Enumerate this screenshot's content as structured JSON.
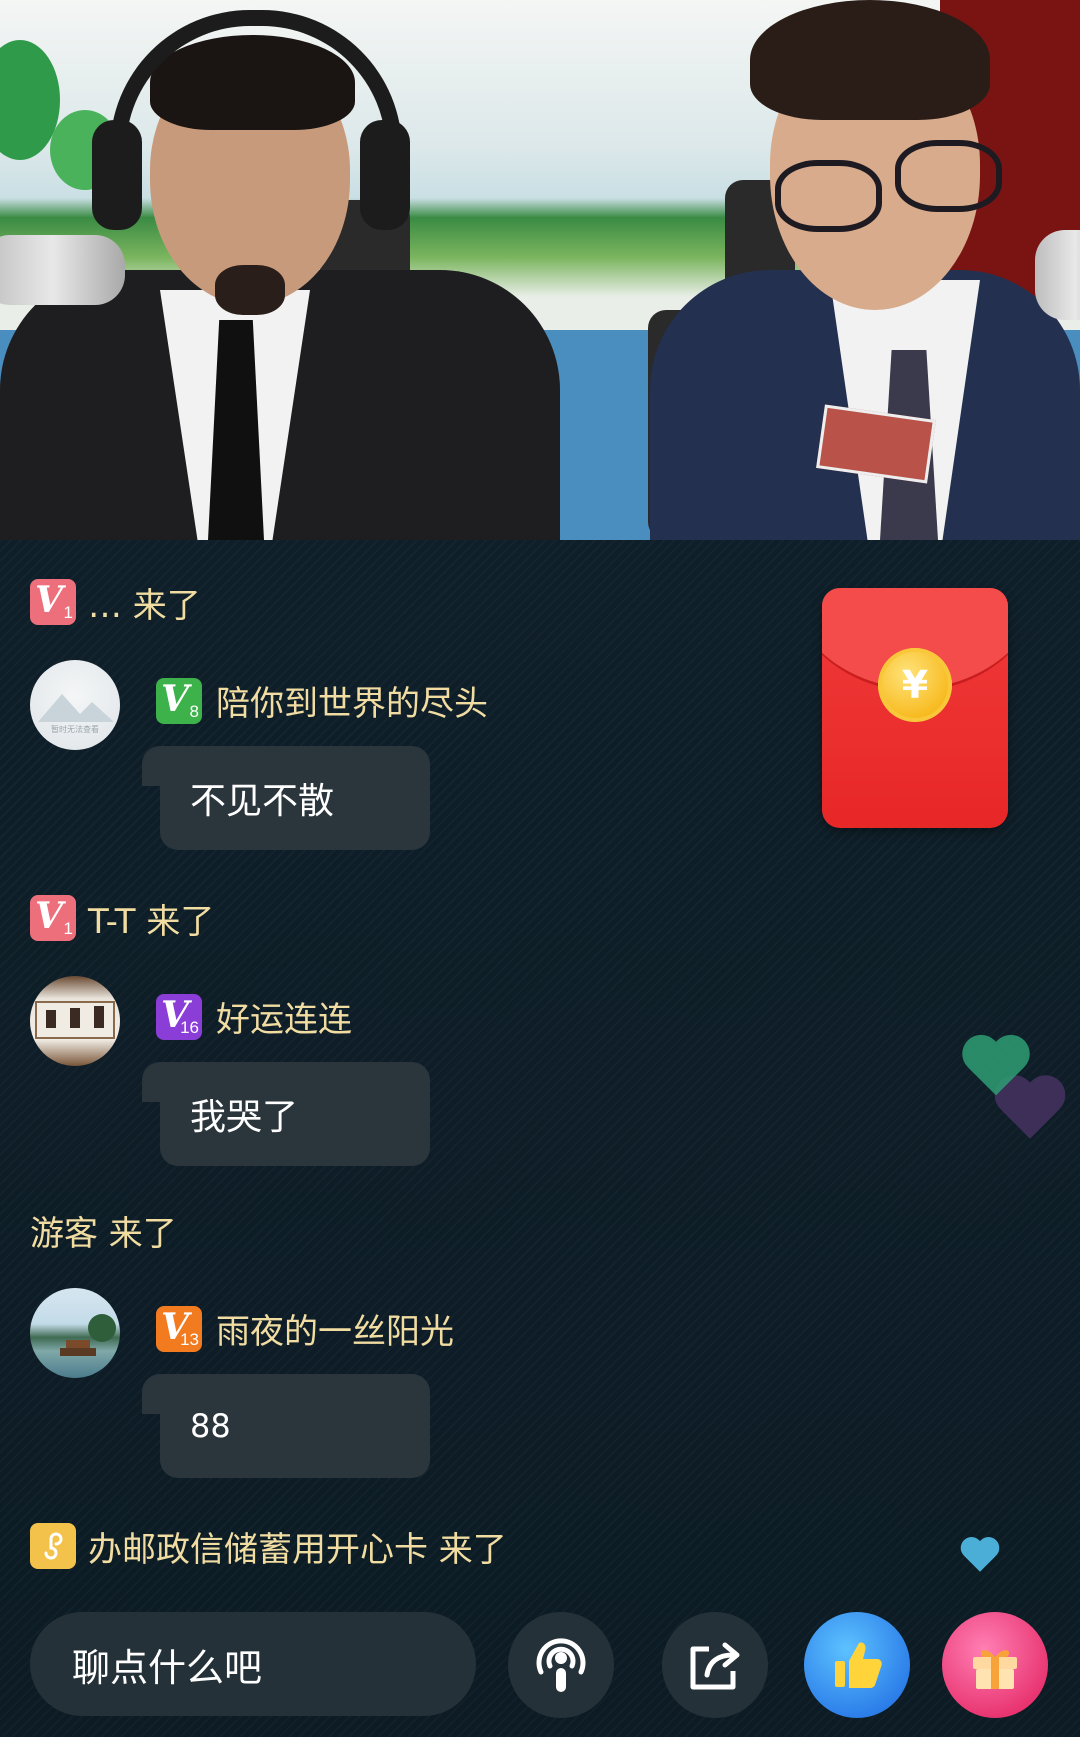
{
  "chat": {
    "entries": [
      {
        "badge_level": "1",
        "text": "… 来了"
      },
      {
        "badge_level": "8",
        "username": "陪你到世界的尽头",
        "message": "不见不散",
        "avatar_caption": "暂时无法查看"
      },
      {
        "badge_level": "1",
        "text": "T-T 来了"
      },
      {
        "badge_level": "16",
        "username": "好运连连",
        "message": "我哭了"
      },
      {
        "text": "游客 来了"
      },
      {
        "badge_level": "13",
        "username": "雨夜的一丝阳光",
        "message": "88"
      },
      {
        "text": "办邮政信储蓄用开心卡 来了"
      }
    ]
  },
  "envelope": {
    "symbol": "¥"
  },
  "input": {
    "placeholder": "聊点什么吧"
  },
  "colors": {
    "username": "#f1dca2",
    "badge_pink": "#ee6f7c",
    "badge_green": "#3db14a",
    "badge_purple": "#8b3dd8",
    "badge_orange": "#f27a1f",
    "envelope_red": "#e82727",
    "bubble_bg": "#2a353c"
  },
  "icons": {
    "podcast": "podcast-icon",
    "share": "share-icon",
    "like": "thumbs-up-icon",
    "gift": "gift-icon"
  }
}
